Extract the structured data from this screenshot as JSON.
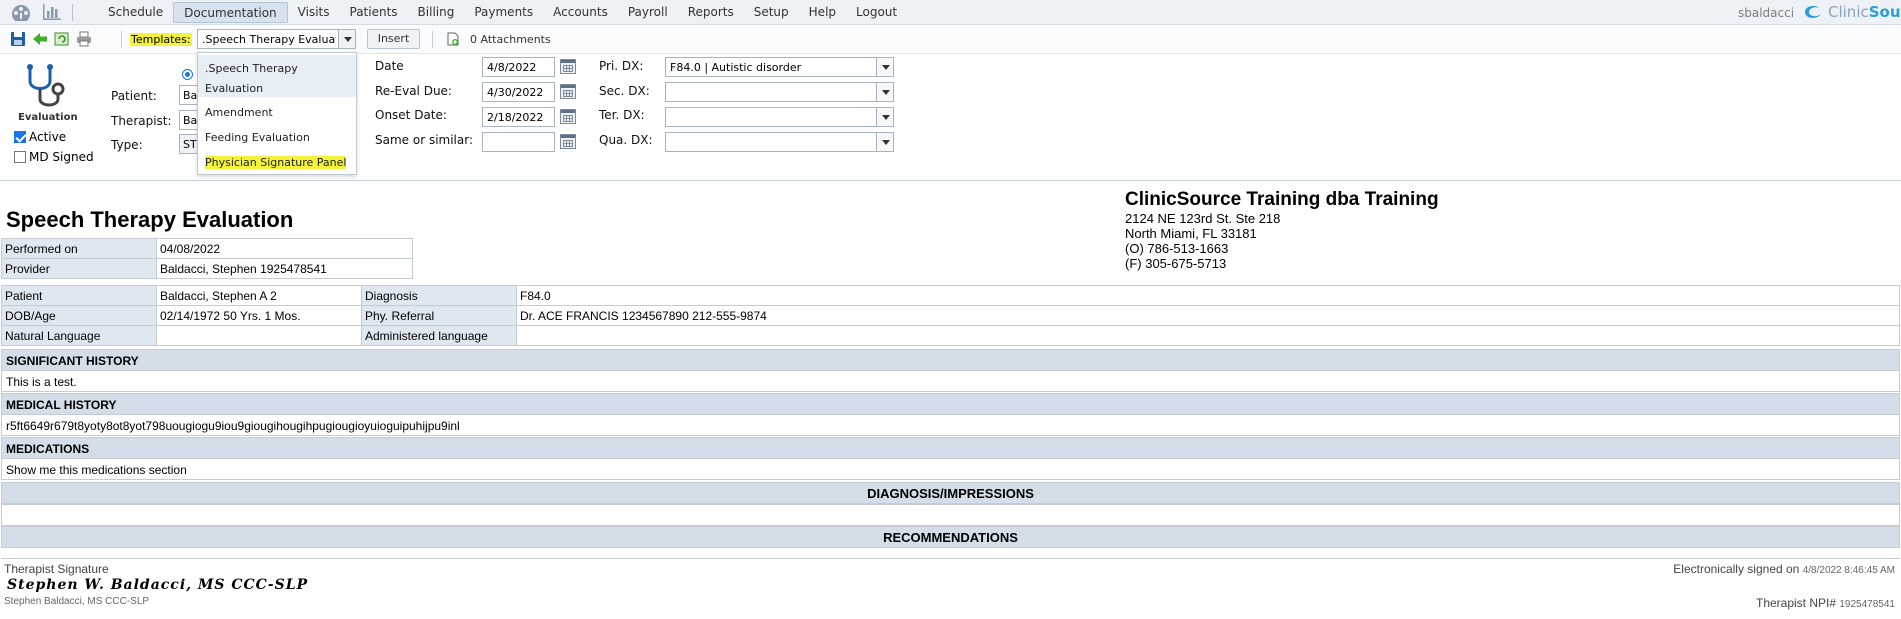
{
  "nav": {
    "menu": [
      "Schedule",
      "Documentation",
      "Visits",
      "Patients",
      "Billing",
      "Payments",
      "Accounts",
      "Payroll",
      "Reports",
      "Setup",
      "Help",
      "Logout"
    ],
    "active": "Documentation",
    "user": "sbaldacci",
    "brand_part1": "Clinic",
    "brand_part2": "Source"
  },
  "toolbar": {
    "templates_label": "Templates:",
    "template_value": ".Speech Therapy Evaluation",
    "insert_label": "Insert",
    "attachments": "0 Attachments"
  },
  "template_options": [
    {
      "label_line1": ".Speech Therapy",
      "label_line2": "Evaluation",
      "selected": true
    },
    {
      "label_line1": "Amendment"
    },
    {
      "label_line1": "Feeding Evaluation"
    },
    {
      "label_line1": "Physician Signature Panel",
      "highlighted": true
    }
  ],
  "header": {
    "eval_label": "Evaluation",
    "active_label": "Active",
    "active_checked": true,
    "md_signed_label": "MD Signed",
    "md_signed_checked": false,
    "patient_label": "Patient:",
    "patient_value": "Ba",
    "therapist_label": "Therapist:",
    "therapist_value": "Ba",
    "type_label": "Type:",
    "type_value": "ST",
    "date_label": "Date",
    "date_value": "4/8/2022",
    "reeval_label": "Re-Eval Due:",
    "reeval_value": "4/30/2022",
    "onset_label": "Onset Date:",
    "onset_value": "2/18/2022",
    "same_label": "Same or similar:",
    "same_value": "",
    "pri_dx_label": "Pri. DX:",
    "pri_dx_value": "F84.0 | Autistic disorder",
    "sec_dx_label": "Sec. DX:",
    "sec_dx_value": "",
    "ter_dx_label": "Ter. DX:",
    "ter_dx_value": "",
    "qua_dx_label": "Qua. DX:",
    "qua_dx_value": ""
  },
  "document": {
    "title": "Speech Therapy Evaluation",
    "clinic": {
      "name": "ClinicSource Training dba Training",
      "address1": "2124 NE 123rd St. Ste 218",
      "address2": "North Miami, FL 33181",
      "phone": "(O) 786-513-1663",
      "fax": "(F) 305-675-5713"
    },
    "performed_on_label": "Performed on",
    "performed_on": "04/08/2022",
    "provider_label": "Provider",
    "provider": "Baldacci, Stephen   1925478541",
    "patient_label": "Patient",
    "patient": "Baldacci, Stephen A 2",
    "diagnosis_label": "Diagnosis",
    "diagnosis": "F84.0",
    "dob_label": "DOB/Age",
    "dob": "02/14/1972  50 Yrs. 1 Mos.",
    "phy_referral_label": "Phy. Referral",
    "phy_referral": "Dr. ACE FRANCIS   1234567890   212-555-9874",
    "natural_language_label": "Natural Language",
    "natural_language": "",
    "administered_language_label": "Administered language",
    "administered_language": "",
    "significant_history_head": "SIGNIFICANT HISTORY",
    "significant_history": "This is a test.",
    "medical_history_head": "MEDICAL HISTORY",
    "medical_history": "r5ft6649r679t8yoty8ot8yot798uougiogu9iou9giougihougihpugiougioyuioguipuhijpu9inl",
    "medications_head": "MEDICATIONS",
    "medications": "Show me this medications section",
    "diagnosis_impressions_head": "DIAGNOSIS/IMPRESSIONS",
    "diagnosis_impressions": "",
    "recommendations_head": "RECOMMENDATIONS"
  },
  "signature": {
    "label": "Therapist Signature",
    "name": "Stephen W. Baldacci, MS CCC-SLP",
    "sub": "Stephen Baldacci, MS CCC-SLP",
    "signed_label": "Electronically signed on",
    "signed_time": "4/8/2022 8:46:45 AM",
    "npi_label": "Therapist NPI#",
    "npi": "1925478541"
  },
  "colors": {
    "highlight": "#f4f33a",
    "brand_blue": "#2a9fd6",
    "section_header": "#d3dee9",
    "label_cell": "#dfe7f0"
  },
  "icons": [
    "app-logo-icon",
    "chart-icon",
    "save-icon",
    "back-arrow-icon",
    "refresh-icon",
    "print-icon",
    "attachment-icon",
    "stethoscope-icon",
    "calendar-icon"
  ]
}
